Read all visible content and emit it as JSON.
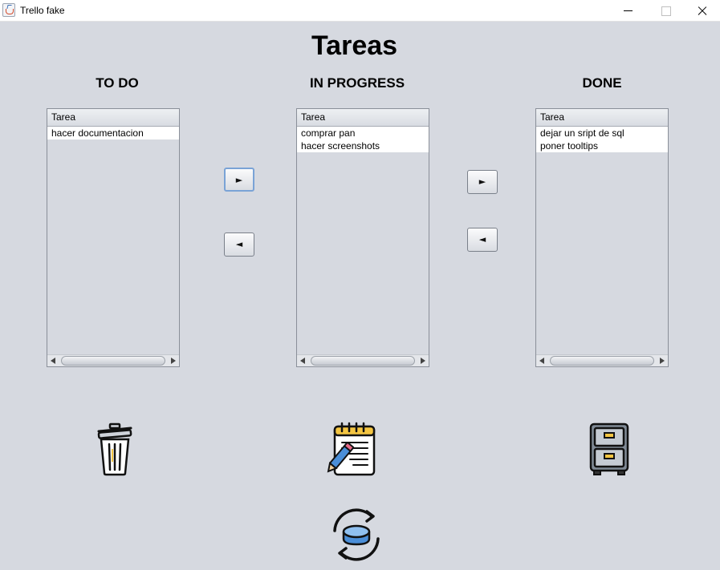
{
  "window": {
    "title": "Trello fake"
  },
  "header": {
    "title": "Tareas"
  },
  "columns": [
    {
      "heading": "TO DO",
      "column_header": "Tarea",
      "rows": [
        "hacer documentacion"
      ]
    },
    {
      "heading": "IN PROGRESS",
      "column_header": "Tarea",
      "rows": [
        "comprar pan",
        "hacer screenshots"
      ]
    },
    {
      "heading": "DONE",
      "column_header": "Tarea",
      "rows": [
        "dejar un sript de sql",
        "poner tooltips"
      ]
    }
  ],
  "buttons": {
    "move_right": "►",
    "move_left": "◄"
  },
  "icons": {
    "delete": "trash-icon",
    "edit": "notepad-pencil-icon",
    "archive": "file-cabinet-icon",
    "sync": "database-sync-icon"
  },
  "colors": {
    "background": "#d6d9e0",
    "row_background": "#ffffff",
    "accent_yellow": "#f4c542",
    "accent_blue": "#4a8ed8"
  }
}
